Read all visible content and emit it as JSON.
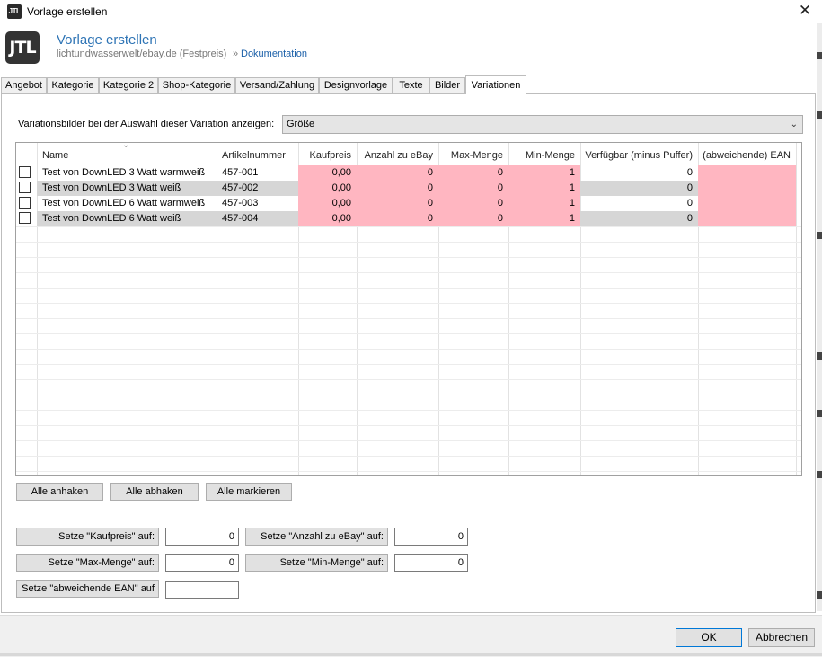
{
  "window": {
    "title": "Vorlage erstellen",
    "app_icon": "JTL",
    "close": "✕"
  },
  "header": {
    "logo": "JTL",
    "title": "Vorlage erstellen",
    "subtitle": "lichtundwasserwelt/ebay.de (Festpreis)",
    "doc_sep": "»",
    "doc_link": "Dokumentation"
  },
  "tabs": [
    {
      "label": "Angebot"
    },
    {
      "label": "Kategorie"
    },
    {
      "label": "Kategorie 2"
    },
    {
      "label": "Shop-Kategorie"
    },
    {
      "label": "Versand/Zahlung"
    },
    {
      "label": "Designvorlage"
    },
    {
      "label": "Texte"
    },
    {
      "label": "Bilder"
    },
    {
      "label": "Variationen"
    }
  ],
  "active_tab": "Variationen",
  "variation": {
    "label": "Variationsbilder bei der Auswahl dieser Variation anzeigen:",
    "selected": "Größe"
  },
  "grid": {
    "columns": [
      "Name",
      "Artikelnummer",
      "Kaufpreis",
      "Anzahl zu eBay",
      "Max-Menge",
      "Min-Menge",
      "Verfügbar (minus Puffer)",
      "(abweichende) EAN"
    ],
    "rows": [
      {
        "name": "Test von DownLED 3 Watt warmweiß",
        "artnr": "457-001",
        "kaufpreis": "0,00",
        "anzahl": "0",
        "max": "0",
        "min": "1",
        "verfuegbar": "0",
        "ean": ""
      },
      {
        "name": "Test von DownLED 3 Watt weiß",
        "artnr": "457-002",
        "kaufpreis": "0,00",
        "anzahl": "0",
        "max": "0",
        "min": "1",
        "verfuegbar": "0",
        "ean": ""
      },
      {
        "name": "Test von DownLED 6 Watt warmweiß",
        "artnr": "457-003",
        "kaufpreis": "0,00",
        "anzahl": "0",
        "max": "0",
        "min": "1",
        "verfuegbar": "0",
        "ean": ""
      },
      {
        "name": "Test von DownLED 6 Watt weiß",
        "artnr": "457-004",
        "kaufpreis": "0,00",
        "anzahl": "0",
        "max": "0",
        "min": "1",
        "verfuegbar": "0",
        "ean": ""
      }
    ]
  },
  "actions": {
    "check_all": "Alle anhaken",
    "uncheck_all": "Alle abhaken",
    "mark_all": "Alle markieren"
  },
  "setters": {
    "kaufpreis": {
      "label": "Setze \"Kaufpreis\" auf:",
      "value": "0"
    },
    "anzahl": {
      "label": "Setze \"Anzahl zu eBay\" auf:",
      "value": "0"
    },
    "max": {
      "label": "Setze \"Max-Menge\" auf:",
      "value": "0"
    },
    "min": {
      "label": "Setze \"Min-Menge\" auf:",
      "value": "0"
    },
    "ean": {
      "label": "Setze \"abweichende EAN\" auf",
      "value": ""
    }
  },
  "footer": {
    "ok": "OK",
    "cancel": "Abbrechen"
  },
  "colors": {
    "accent": "#2e74b5",
    "required_cell": "#ffb6c1",
    "readonly_cell": "#d6d6d6"
  }
}
